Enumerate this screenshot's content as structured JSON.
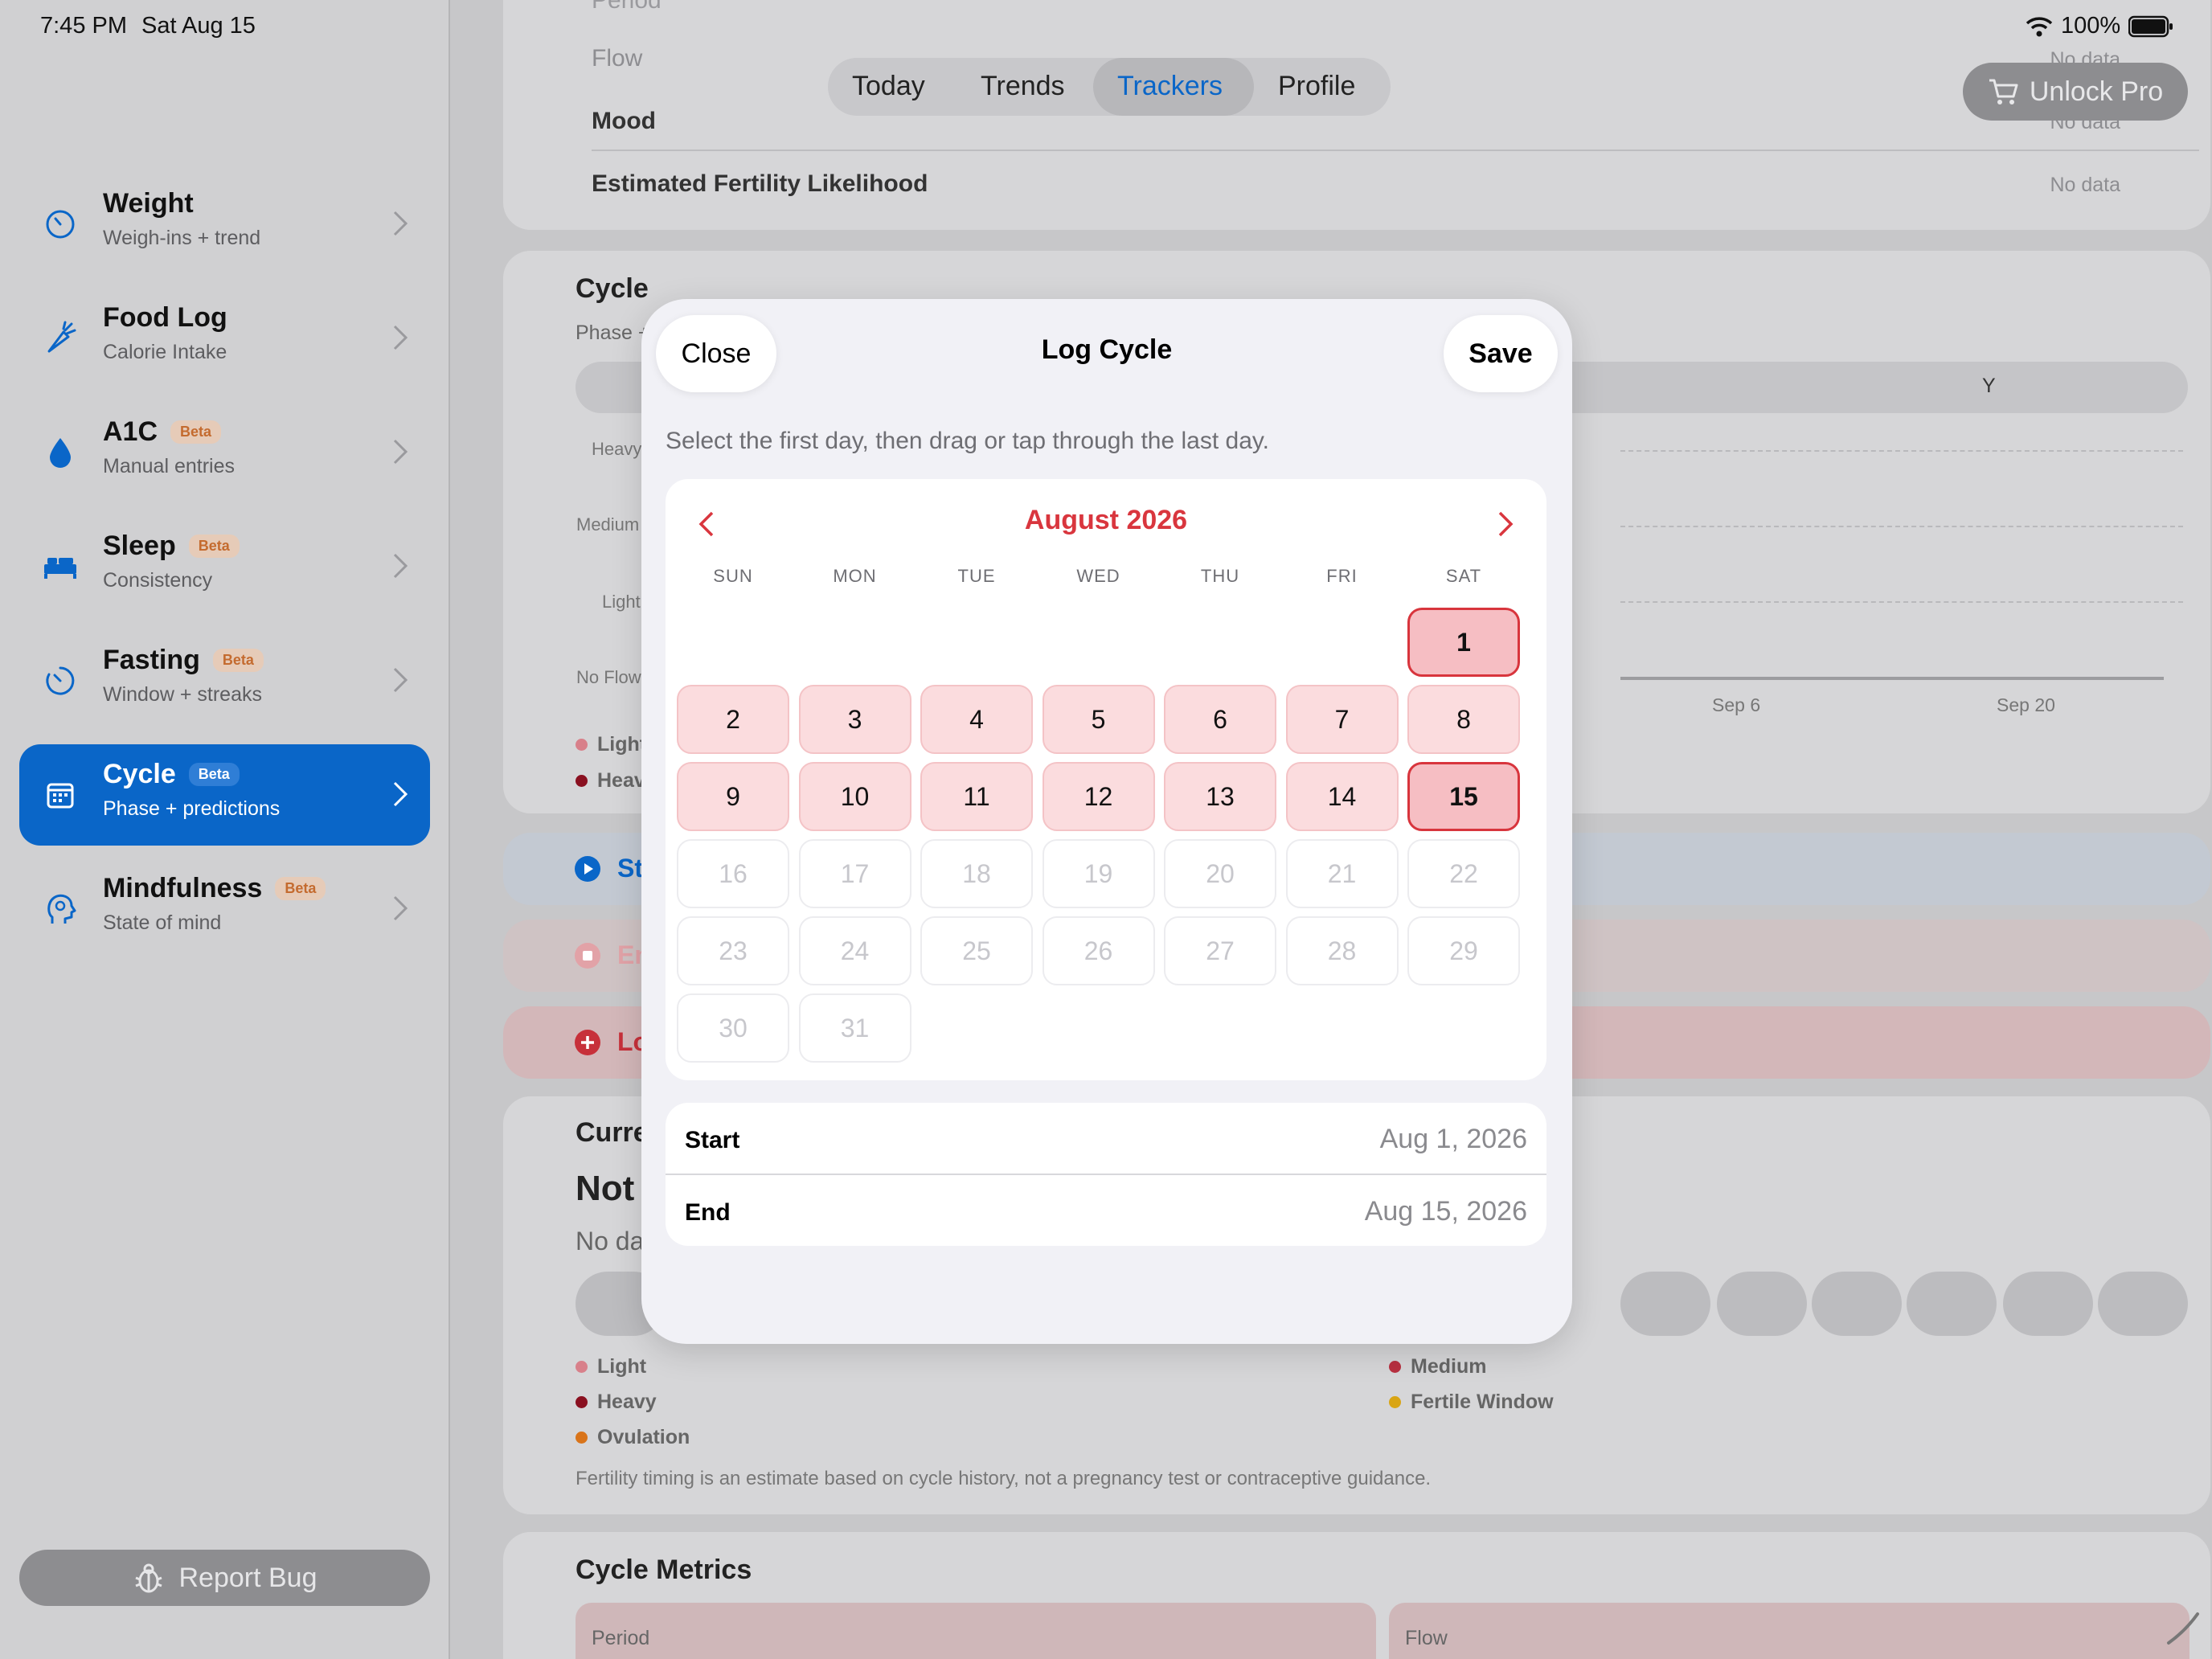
{
  "status": {
    "time": "7:45 PM",
    "date": "Sat Aug 15",
    "battery": "100%"
  },
  "sidebar": {
    "items": [
      {
        "title": "Weight",
        "subtitle": "Weigh-ins + trend",
        "beta": ""
      },
      {
        "title": "Food Log",
        "subtitle": "Calorie Intake",
        "beta": ""
      },
      {
        "title": "A1C",
        "subtitle": "Manual entries",
        "beta": "Beta"
      },
      {
        "title": "Sleep",
        "subtitle": "Consistency",
        "beta": "Beta"
      },
      {
        "title": "Fasting",
        "subtitle": "Window + streaks",
        "beta": "Beta"
      },
      {
        "title": "Cycle",
        "subtitle": "Phase + predictions",
        "beta": "Beta"
      },
      {
        "title": "Mindfulness",
        "subtitle": "State of mind",
        "beta": "Beta"
      }
    ],
    "report_label": "Report Bug"
  },
  "tabs": {
    "today": "Today",
    "trends": "Trends",
    "trackers": "Trackers",
    "profile": "Profile"
  },
  "unlock_label": "Unlock Pro",
  "background": {
    "top_rows": [
      {
        "label": "Period",
        "value": "No data"
      },
      {
        "label": "Flow",
        "value": "No data"
      },
      {
        "label": "Mood",
        "value": "No data"
      },
      {
        "label": "Estimated Fertility Likelihood",
        "value": "No data"
      }
    ],
    "cycle_title": "Cycle",
    "cycle_sub": "Phase + pred",
    "range_label": "Y",
    "y_labels": [
      "Heavy",
      "Medium",
      "Light",
      "No Flow"
    ],
    "x_labels": [
      "Sep 6",
      "Sep 20"
    ],
    "legend_top": [
      "Light",
      "Heavy"
    ],
    "actions": [
      "Start I",
      "End Pe",
      "Log Cy"
    ],
    "current_title": "Current S",
    "current_value": "Not End",
    "current_nodata": "No data",
    "legend": [
      "Light",
      "Medium",
      "Heavy",
      "Fertile Window",
      "Ovulation"
    ],
    "disclaimer": "Fertility timing is an estimate based on cycle history, not a pregnancy test or contraceptive guidance.",
    "metrics_title": "Cycle Metrics",
    "metrics": [
      "Period",
      "Flow"
    ]
  },
  "modal": {
    "close": "Close",
    "title": "Log Cycle",
    "save": "Save",
    "hint": "Select the first day, then drag or tap through the last day.",
    "month": "August 2026",
    "weekdays": [
      "SUN",
      "MON",
      "TUE",
      "WED",
      "THU",
      "FRI",
      "SAT"
    ],
    "first_weekday_index": 6,
    "days_in_month": 31,
    "range_start": 1,
    "range_end": 15,
    "today": 15,
    "start_label": "Start",
    "start_value": "Aug 1, 2026",
    "end_label": "End",
    "end_value": "Aug 15, 2026"
  },
  "colors": {
    "accent": "#0a66c8",
    "cycle_red": "#d9363e",
    "selected_fill": "#fbdcde"
  }
}
